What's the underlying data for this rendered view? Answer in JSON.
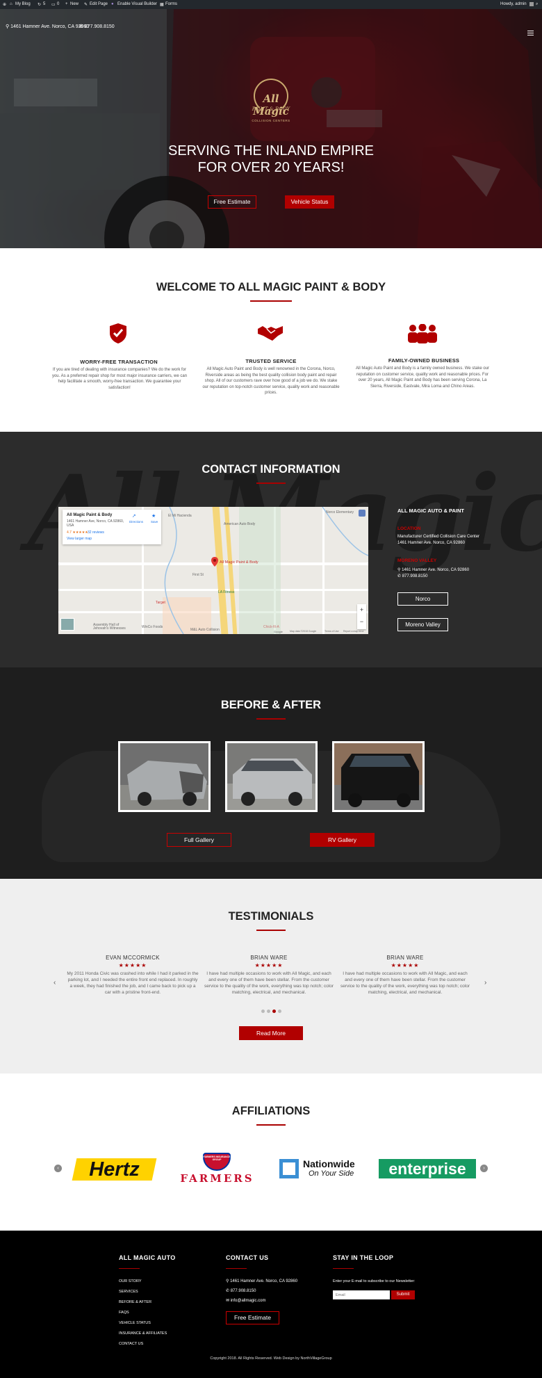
{
  "admin_bar": {
    "items": [
      "My Blog",
      "5",
      "0",
      "New",
      "Edit Page",
      "Enable Visual Builder",
      "Forms"
    ],
    "greeting": "Howdy, admin"
  },
  "hero": {
    "address": "1461 Hamner Ave. Norco, CA 92860",
    "phone": "877.908.8150",
    "logo": {
      "name": "All Magic",
      "sub": "PAINT & BODY",
      "tag": "COLLISION CENTERS"
    },
    "title_line1": "SERVING THE INLAND EMPIRE",
    "title_line2": "FOR OVER 20 YEARS!",
    "btn_estimate": "Free Estimate",
    "btn_status": "Vehicle Status"
  },
  "welcome": {
    "title": "WELCOME TO ALL MAGIC PAINT & BODY",
    "features": [
      {
        "icon": "shield-check-icon",
        "title": "WORRY-FREE TRANSACTION",
        "text": "If you are tired of dealing with insurance companies? We do the work for you. As a preferred repair shop for most major insurance carriers, we can help facilitate a smooth, worry-free transaction. We guarantee your satisfaction!"
      },
      {
        "icon": "handshake-icon",
        "title": "TRUSTED SERVICE",
        "text": "All Magic Auto Paint and Body is well renowned in the Corona, Norco, Riverside areas as being the best quality collision body paint and repair shop. All of our customers rave over how good of a job we do. We stake our reputation on top-notch customer service, quality work and reasonable prices."
      },
      {
        "icon": "family-group-icon",
        "title": "FAMILY-OWNED BUSINESS",
        "text": "All Magic Auto Paint and Body is a family owned business. We stake our reputation on customer service, quality work and reasonable prices. For over 20 years, All Magic Paint and Body has been serving Corona, La Sierra, Riverside, Eastvale, Mira Loma and Chino Areas."
      }
    ]
  },
  "contact": {
    "title": "CONTACT INFORMATION",
    "map": {
      "card_title": "All Magic Paint & Body",
      "card_address": "1461 Hamner Ave, Norco, CA 92860, USA",
      "card_rating": "4.7 ★★★★★",
      "card_reviews": "32 reviews",
      "card_larger": "View larger map",
      "directions": "Directions",
      "save": "Save",
      "pin_label": "All Magic Paint & Body",
      "labels": [
        "Norco Elementary",
        "American Auto Body",
        "El Mi Hacienda",
        "First St",
        "LA Fitness",
        "Target",
        "Assembly Hall of Jehovah's Witnesses",
        "WinCo Foods",
        "M&L Auto Collision",
        "Chick-fil-A",
        "Google",
        "Map data ©2018 Google",
        "Terms of Use",
        "Report a map error"
      ],
      "zoom_in": "+",
      "zoom_out": "−"
    },
    "company": "ALL MAGIC AUTO & PAINT",
    "location_label": "LOCATION",
    "location_line1": "Manufacturer Certified Collision Care Center",
    "location_line2": "1461 Hamner Ave. Norco, CA 92860",
    "moreno_label": "MORENO VALLEY",
    "address": "1461 Hamner Ave. Norco, CA 92860",
    "phone": "877.908.8150",
    "btn_norco": "Norco",
    "btn_moreno": "Moreno Valley"
  },
  "before_after": {
    "title": "BEFORE & AFTER",
    "btn_full": "Full Gallery",
    "btn_rv": "RV Gallery"
  },
  "testimonials": {
    "title": "TESTIMONIALS",
    "items": [
      {
        "name": "EVAN MCCORMICK",
        "stars": "★★★★★",
        "text": "My 2011 Honda Civic was crashed into while I had it parked in the parking lot, and I needed the entire front end replaced. In roughly a week, they had finished the job, and I came back to pick up a car with a pristine front-end."
      },
      {
        "name": "BRIAN WARE",
        "stars": "★★★★★",
        "text": "I have had multiple occasions to work with All Magic, and each and every one of them have been stellar. From the customer service to the quality of the work, everything was top notch; color matching, electrical, and mechanical."
      },
      {
        "name": "BRIAN WARE",
        "stars": "★★★★★",
        "text": "I have had multiple occasions to work with All Magic, and each and every one of them have been stellar. From the customer service to the quality of the work, everything was top notch; color matching, electrical, and mechanical."
      }
    ],
    "prev": "‹",
    "next": "›",
    "btn_more": "Read More"
  },
  "affiliations": {
    "title": "AFFILIATIONS",
    "logos": {
      "hertz": "Hertz",
      "farmers_badge": "FARMERS INSURANCE GROUP",
      "farmers": "FARMERS",
      "nationwide": "Nationwide",
      "nationwide_tag": "On Your Side",
      "enterprise": "enterprise"
    },
    "prev": "‹",
    "next": "›"
  },
  "footer": {
    "col1_title": "ALL MAGIC AUTO",
    "links": [
      "OUR STORY",
      "SERVICES",
      "BEFORE & AFTER",
      "FAQS",
      "VEHICLE STATUS",
      "INSURANCE & AFFILIATES",
      "CONTACT US"
    ],
    "col2_title": "CONTACT US",
    "address": "1461 Hamner Ave. Norco, CA 92860",
    "phone": "877.908.8150",
    "email": "info@allmagic.com",
    "btn_estimate": "Free Estimate",
    "col3_title": "STAY IN THE LOOP",
    "newsletter_text": "Enter your E-mail to subscribe to our Newsletter:",
    "email_placeholder": "Email",
    "btn_submit": "Submit",
    "copyright": "Copyright 2018. All Rights Reserved. Web Design by NorthVillageGroup"
  },
  "colors": {
    "accent": "#b10000",
    "dark": "#2c2c2c",
    "footer": "#000000"
  }
}
